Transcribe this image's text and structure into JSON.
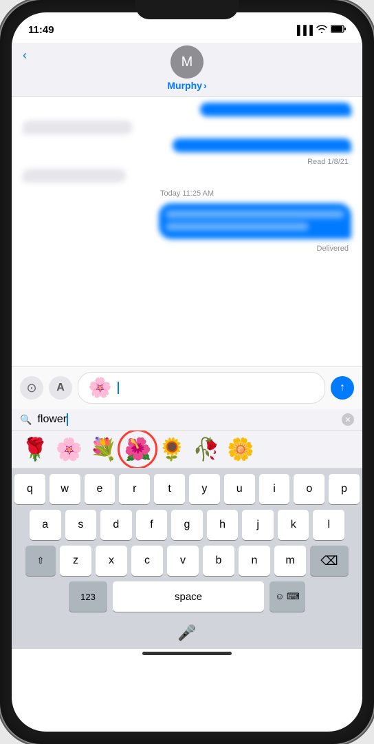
{
  "status_bar": {
    "time": "11:49",
    "signal_icon": "signal",
    "wifi_icon": "wifi",
    "battery_icon": "battery"
  },
  "nav": {
    "back_label": "‹",
    "contact_initial": "M",
    "contact_name": "Murphy",
    "chevron": "›"
  },
  "messages": [
    {
      "type": "sent",
      "text": "blurred sent message",
      "blurred": true
    },
    {
      "type": "received",
      "text": "blurred received message",
      "blurred": true
    },
    {
      "type": "sent",
      "text": "blurred sent message 2",
      "blurred": true
    },
    {
      "type": "meta",
      "text": "Read 1/8/21"
    },
    {
      "type": "received",
      "text": "blurred received message 2",
      "blurred": true
    },
    {
      "type": "timestamp",
      "text": "Today 11:25 AM"
    },
    {
      "type": "sent",
      "text": "blurred sent long message",
      "blurred": true
    },
    {
      "type": "meta",
      "text": "Delivered"
    }
  ],
  "input": {
    "emoji_preview": "🌸",
    "camera_icon": "📷",
    "app_icon": "🅐",
    "send_icon": "↑"
  },
  "emoji_search": {
    "placeholder": "flower",
    "search_term": "flower",
    "clear_icon": "✕",
    "results": [
      "🌹",
      "🌸",
      "💐",
      "🌺",
      "🌻",
      "🥀",
      "🌼"
    ],
    "highlighted_index": 3
  },
  "keyboard": {
    "rows": [
      [
        "q",
        "w",
        "e",
        "r",
        "t",
        "y",
        "u",
        "i",
        "o",
        "p"
      ],
      [
        "a",
        "s",
        "d",
        "f",
        "g",
        "h",
        "j",
        "k",
        "l"
      ],
      [
        "z",
        "x",
        "c",
        "v",
        "b",
        "n",
        "m"
      ]
    ],
    "special": {
      "shift": "⇧",
      "delete": "⌫",
      "numbers": "123",
      "space": "space",
      "emoji": "☺",
      "mic": "🎤"
    }
  }
}
